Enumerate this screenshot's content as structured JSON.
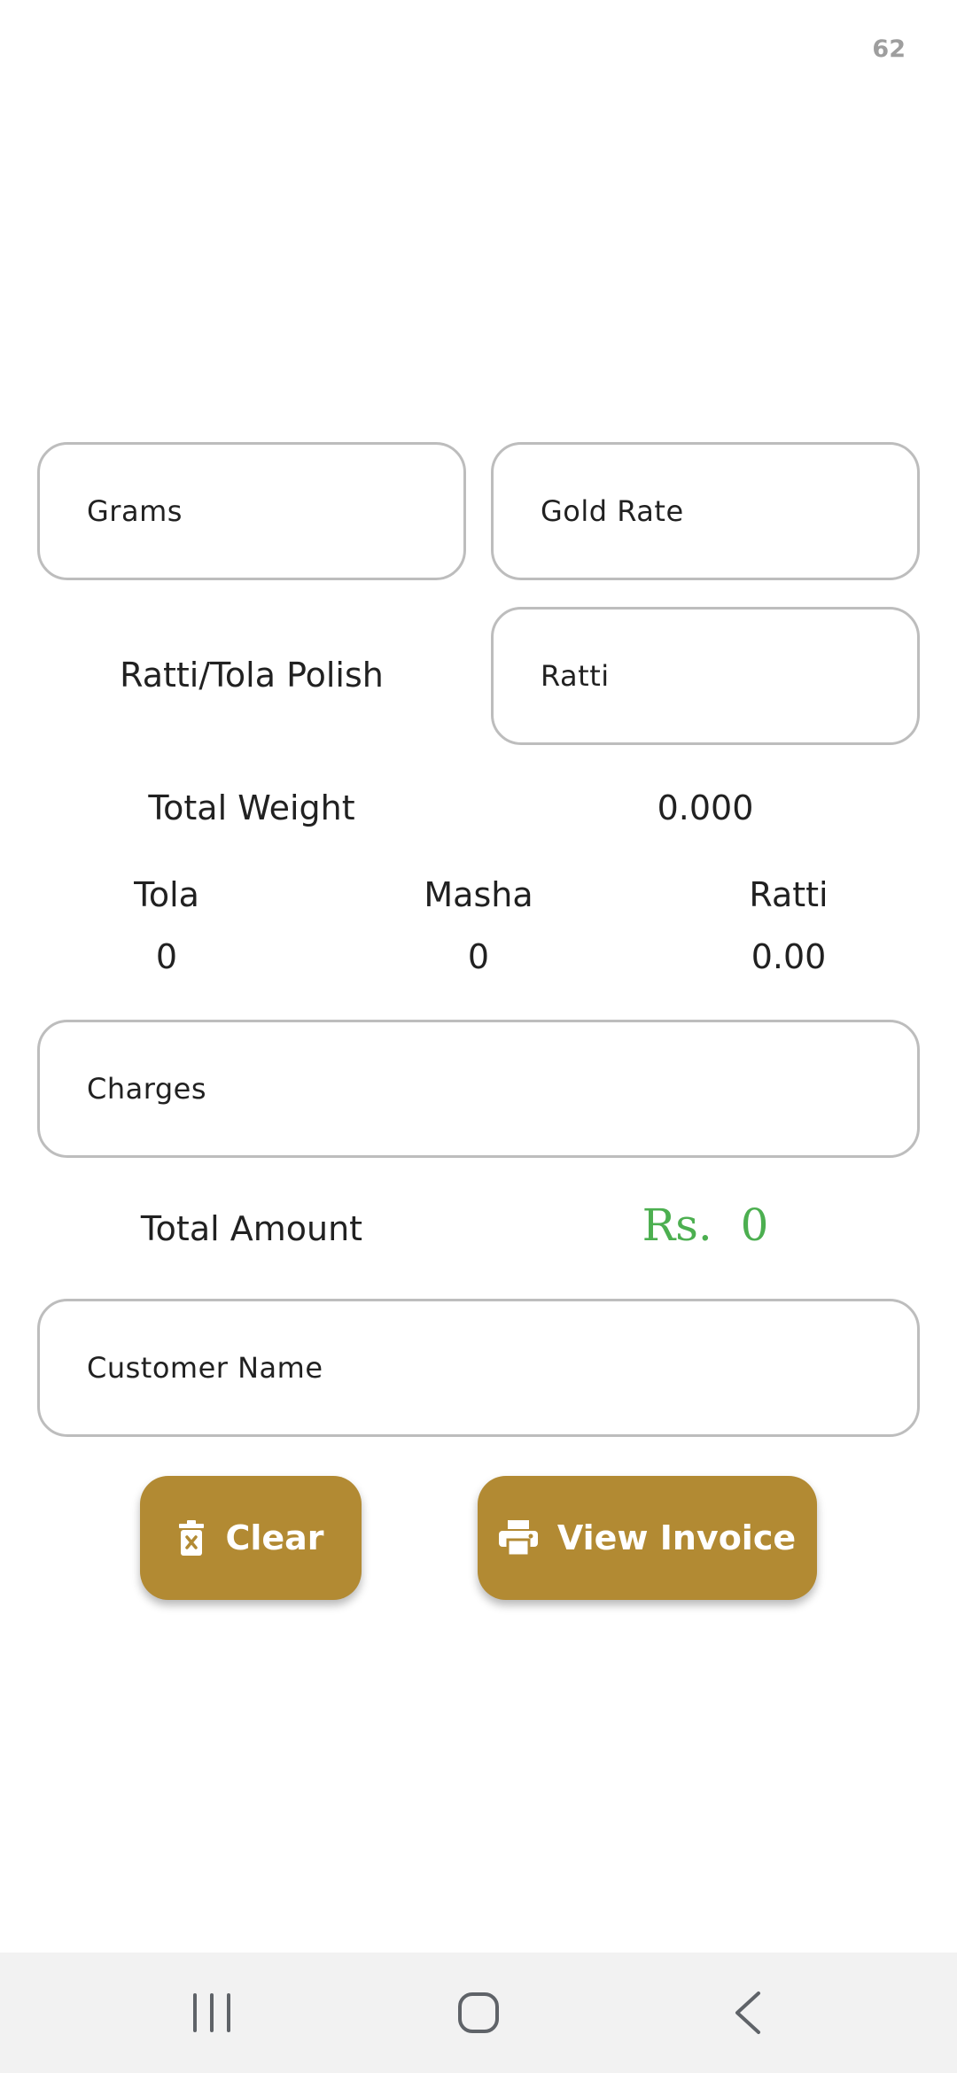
{
  "header": {
    "counter": "62"
  },
  "form": {
    "grams_placeholder": "Grams",
    "gold_rate_placeholder": "Gold Rate",
    "polish_label": "Ratti/Tola Polish",
    "ratti_placeholder": "Ratti",
    "charges_placeholder": "Charges",
    "customer_name_placeholder": "Customer Name"
  },
  "weight": {
    "total_label": "Total Weight",
    "total_value": "0.000",
    "units": [
      {
        "label": "Tola",
        "value": "0"
      },
      {
        "label": "Masha",
        "value": "0"
      },
      {
        "label": "Ratti",
        "value": "0.00"
      }
    ]
  },
  "amount": {
    "label": "Total Amount",
    "value": "Rs.  0"
  },
  "actions": {
    "clear_label": "Clear",
    "view_invoice_label": "View Invoice"
  },
  "colors": {
    "accent": "#b28a33",
    "amount_green": "#4caf50",
    "field_border": "#bdbdbd",
    "navbar_bg": "#f2f2f2"
  },
  "icons": {
    "clear": "delete-icon",
    "view_invoice": "print-icon",
    "nav_recents": "recents-icon",
    "nav_home": "home-icon",
    "nav_back": "back-icon"
  }
}
